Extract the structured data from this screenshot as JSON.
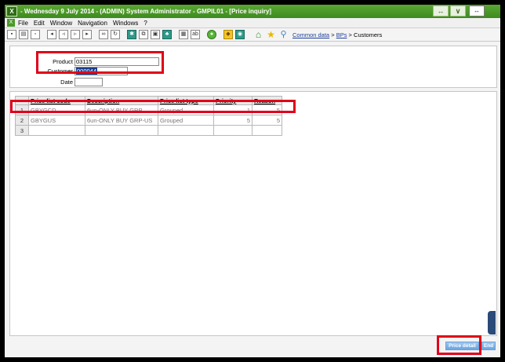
{
  "window": {
    "title": "- Wednesday 9 July 2014 - (ADMIN) System Administrator - GMPIL01 - [Price inquiry]",
    "controls": [
      "↔",
      "∨",
      "↔"
    ]
  },
  "menu": {
    "items": [
      "File",
      "Edit",
      "Window",
      "Navigation",
      "Windows",
      "?"
    ]
  },
  "breadcrumb": {
    "items": [
      "Common data",
      "BPs",
      "Customers"
    ],
    "separator": ">"
  },
  "header": {
    "product_label": "Product",
    "product_value": "03115",
    "customer_label": "Customer",
    "customer_value": "000044",
    "date_label": "Date",
    "date_value": ""
  },
  "table": {
    "columns": [
      "Price list code",
      "Description",
      "Price list type",
      "Priority",
      "Reason"
    ],
    "rows": [
      {
        "num": "1",
        "code": "GBYGCD",
        "description": "6un-ONLY BUY GRP",
        "type": "Grouped",
        "priority": "1",
        "reason": "5"
      },
      {
        "num": "2",
        "code": "GBYGUS",
        "description": "6un-ONLY BUY GRP-US",
        "type": "Grouped",
        "priority": "5",
        "reason": "5"
      },
      {
        "num": "3",
        "code": "",
        "description": "",
        "type": "",
        "priority": "",
        "reason": ""
      }
    ]
  },
  "buttons": {
    "price_detail": "Price detail",
    "end": "End"
  },
  "colors": {
    "titlebar": "#4a9a28",
    "highlight_box": "#e0001a",
    "button": "#7ab0e6"
  }
}
